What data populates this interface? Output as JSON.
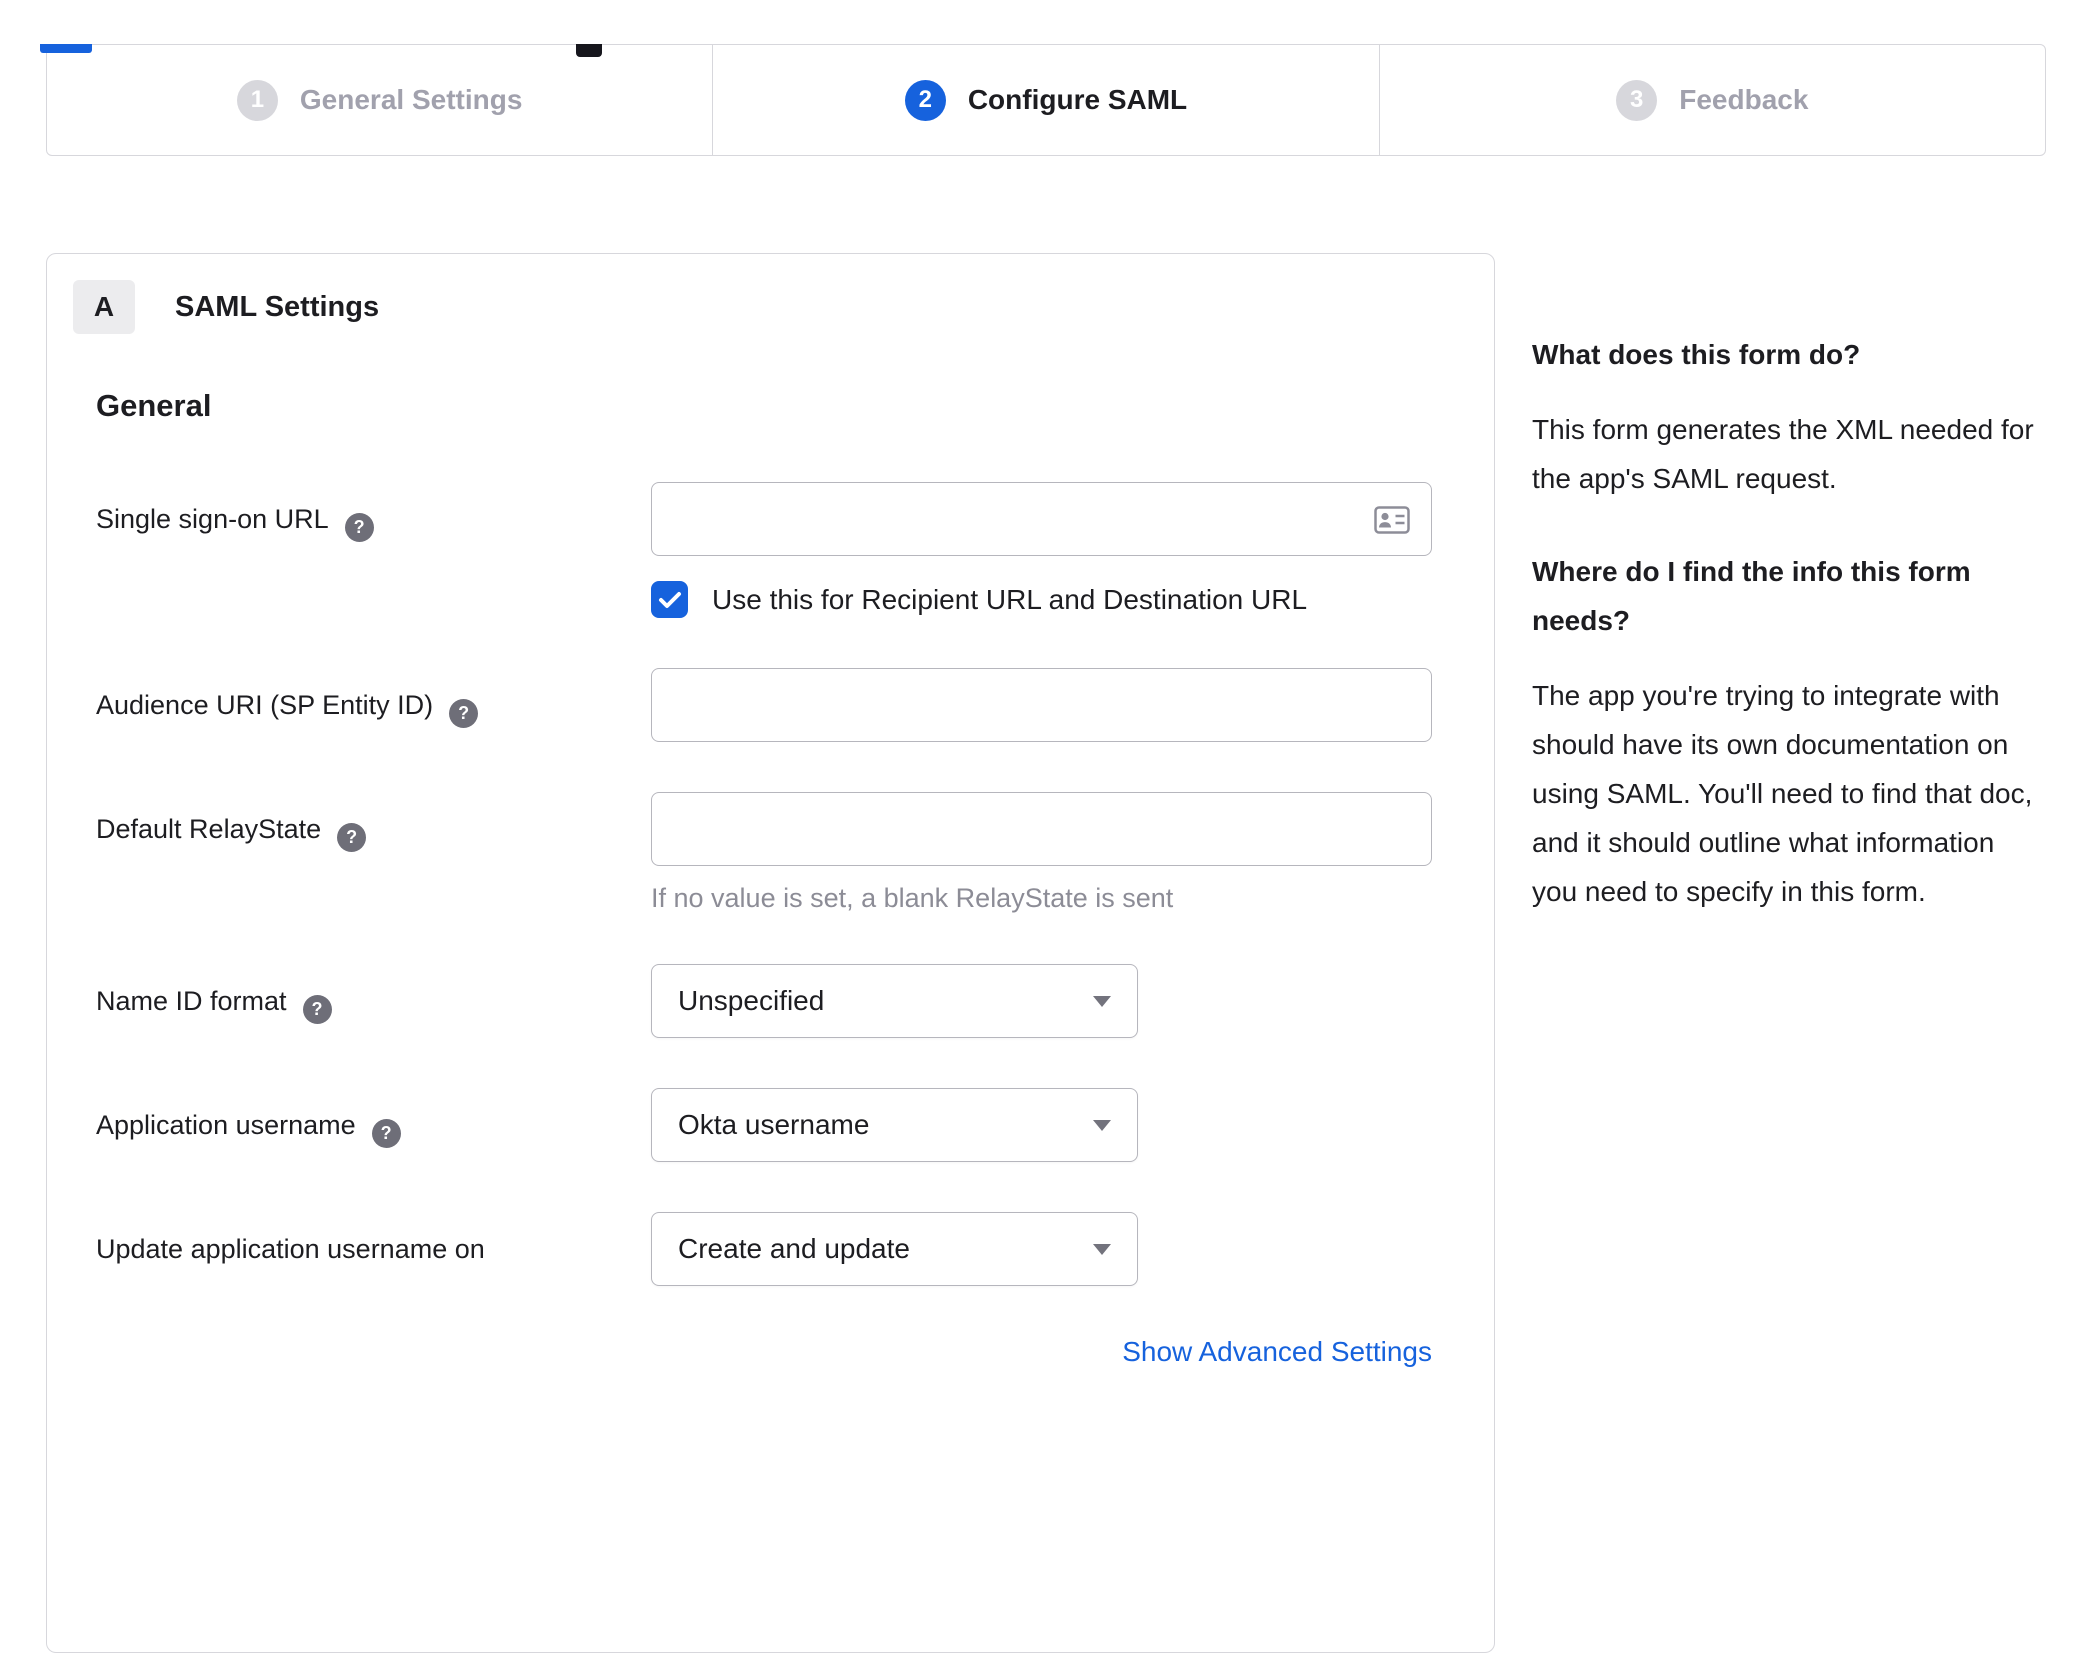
{
  "stepper": {
    "steps": [
      {
        "number": "1",
        "label": "General Settings",
        "state": "inactive"
      },
      {
        "number": "2",
        "label": "Configure SAML",
        "state": "active"
      },
      {
        "number": "3",
        "label": "Feedback",
        "state": "inactive"
      }
    ]
  },
  "panel": {
    "section_badge": "A",
    "section_title": "SAML Settings",
    "group_title": "General",
    "fields": {
      "sso_url": {
        "label": "Single sign-on URL",
        "value": ""
      },
      "recipient_checkbox": {
        "label": "Use this for Recipient URL and Destination URL",
        "checked": true
      },
      "audience_uri": {
        "label": "Audience URI (SP Entity ID)",
        "value": ""
      },
      "default_relay_state": {
        "label": "Default RelayState",
        "value": "",
        "hint": "If no value is set, a blank RelayState is sent"
      },
      "name_id_format": {
        "label": "Name ID format",
        "value": "Unspecified"
      },
      "application_username": {
        "label": "Application username",
        "value": "Okta username"
      },
      "update_application_username_on": {
        "label": "Update application username on",
        "value": "Create and update"
      }
    },
    "advanced_link": "Show Advanced Settings"
  },
  "sidebar": {
    "sections": [
      {
        "heading": "What does this form do?",
        "body": "This form generates the XML needed for the app's SAML request."
      },
      {
        "heading": "Where do I find the info this form needs?",
        "body": "The app you're trying to integrate with should have its own documentation on using SAML. You'll need to find that doc, and it should outline what information you need to specify in this form."
      }
    ]
  },
  "icons": {
    "help": "?"
  },
  "colors": {
    "accent_blue": "#1662dd",
    "inactive_gray": "#d7d7dc",
    "text_dark": "#1d1d21",
    "muted_text": "#a1a1ad",
    "border": "#d7d7dc",
    "input_border": "#b6b6bd",
    "hint_text": "#8c8c96",
    "help_icon_bg": "#6e6e78"
  }
}
